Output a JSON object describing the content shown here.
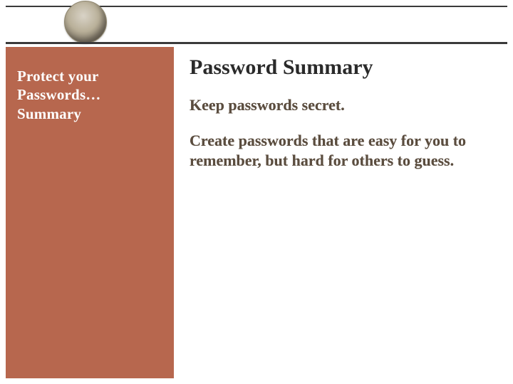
{
  "sidebar": {
    "title": "Protect your Passwords… Summary"
  },
  "main": {
    "title": "Password Summary",
    "points": [
      "Keep passwords secret.",
      "Create passwords that are easy for you to remember, but hard for others to guess."
    ]
  }
}
